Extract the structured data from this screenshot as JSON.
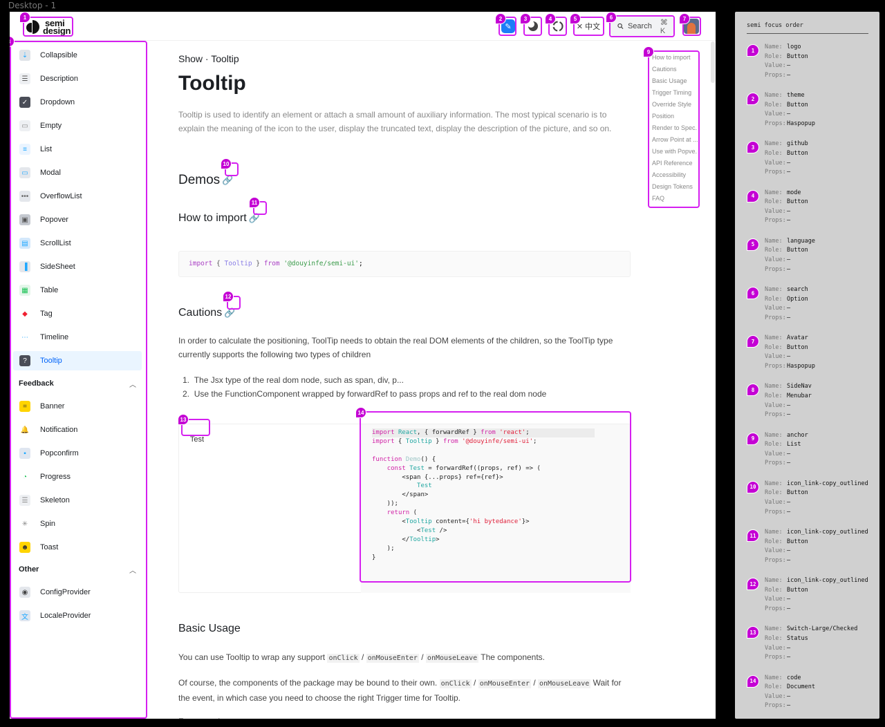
{
  "frame_label": "Desktop - 1",
  "header": {
    "logo_line1": "semi",
    "logo_line2": "design",
    "language_label": "中文",
    "search_label": "Search",
    "search_shortcut": "⌘ K",
    "icons": [
      "theme-icon",
      "mode-icon",
      "github-icon",
      "translate-icon",
      "search-icon",
      "avatar"
    ]
  },
  "sidebar": {
    "items_top": [
      {
        "label": "Collapsible",
        "icon": "collapsible-icon"
      },
      {
        "label": "Description",
        "icon": "description-icon"
      },
      {
        "label": "Dropdown",
        "icon": "dropdown-icon"
      },
      {
        "label": "Empty",
        "icon": "empty-icon"
      },
      {
        "label": "List",
        "icon": "list-icon"
      },
      {
        "label": "Modal",
        "icon": "modal-icon"
      },
      {
        "label": "OverflowList",
        "icon": "overflowlist-icon"
      },
      {
        "label": "Popover",
        "icon": "popover-icon"
      },
      {
        "label": "ScrollList",
        "icon": "scrolllist-icon"
      },
      {
        "label": "SideSheet",
        "icon": "sidesheet-icon"
      },
      {
        "label": "Table",
        "icon": "table-icon"
      },
      {
        "label": "Tag",
        "icon": "tag-icon"
      },
      {
        "label": "Timeline",
        "icon": "timeline-icon"
      },
      {
        "label": "Tooltip",
        "icon": "tooltip-icon",
        "active": true
      }
    ],
    "group_feedback": "Feedback",
    "items_feedback": [
      {
        "label": "Banner",
        "icon": "banner-icon"
      },
      {
        "label": "Notification",
        "icon": "notification-icon"
      },
      {
        "label": "Popconfirm",
        "icon": "popconfirm-icon"
      },
      {
        "label": "Progress",
        "icon": "progress-icon"
      },
      {
        "label": "Skeleton",
        "icon": "skeleton-icon"
      },
      {
        "label": "Spin",
        "icon": "spin-icon"
      },
      {
        "label": "Toast",
        "icon": "toast-icon"
      }
    ],
    "group_other": "Other",
    "items_other": [
      {
        "label": "ConfigProvider",
        "icon": "configprovider-icon"
      },
      {
        "label": "LocaleProvider",
        "icon": "localeprovider-icon"
      }
    ]
  },
  "main": {
    "breadcrumb": "Show · Tooltip",
    "title": "Tooltip",
    "intro": "Tooltip is used to identify an element or attach a small amount of auxiliary information. The most typical scenario is to explain the meaning of the icon to the user, display the truncated text, display the description of the picture, and so on.",
    "demos_heading": "Demos",
    "how_to_import_heading": "How to import",
    "import_code": {
      "kw": "import",
      "open": " { ",
      "cmp": "Tooltip",
      "close": " } ",
      "from": "from",
      "str": " '@douyinfe/semi-ui'",
      "end": ";"
    },
    "cautions_heading": "Cautions",
    "cautions_text": "In order to calculate the positioning, ToolTip needs to obtain the real DOM elements of the children, so the ToolTip type currently supports the following two types of children",
    "cautions_list": [
      "The Jsx type of the real dom node, such as span, div, p...",
      "Use the FunctionComponent wrapped by forwardRef to pass props and ref to the real dom node"
    ],
    "demo_test_label": "Test",
    "basic_usage_heading": "Basic Usage",
    "basic_p1_before": "You can use Tooltip to wrap any support ",
    "basic_p1_after": " The components.",
    "basic_p2_before": "Of course, the components of the package may be bound to their own. ",
    "basic_p2_after": " Wait for the event, in which case you need to choose the right Trigger time for Tooltip.",
    "code_onclick": "onClick",
    "code_onmouseenter": "onMouseEnter",
    "code_onmouseleave": "onMouseLeave",
    "slash": " / ",
    "for_example": "For example:"
  },
  "anchor": {
    "items": [
      "How to import",
      "Cautions",
      "Basic Usage",
      "Trigger Timing",
      "Override Style",
      "Position",
      "Render to Spec.",
      "Arrow Point at ...",
      "Use with Popve.",
      "API Reference",
      "Accessibility",
      "Design Tokens",
      "FAQ"
    ]
  },
  "focus_panel": {
    "title": "semi focus order",
    "keys": {
      "name": "Name:",
      "role": "Role:",
      "value": "Value:",
      "props": "Props:"
    },
    "entries": [
      {
        "n": "1",
        "name": "logo",
        "role": "Button",
        "value": "–",
        "props": "–"
      },
      {
        "n": "2",
        "name": "theme",
        "role": "Button",
        "value": "–",
        "props": "Haspopup"
      },
      {
        "n": "3",
        "name": "github",
        "role": "Button",
        "value": "–",
        "props": "–"
      },
      {
        "n": "4",
        "name": "mode",
        "role": "Button",
        "value": "–",
        "props": "–"
      },
      {
        "n": "5",
        "name": "language",
        "role": "Button",
        "value": "–",
        "props": "–"
      },
      {
        "n": "6",
        "name": "search",
        "role": "Option",
        "value": "–",
        "props": "–"
      },
      {
        "n": "7",
        "name": "Avatar",
        "role": "Button",
        "value": "–",
        "props": "Haspopup"
      },
      {
        "n": "8",
        "name": "SideNav",
        "role": "Menubar",
        "value": "–",
        "props": "–"
      },
      {
        "n": "9",
        "name": "anchor",
        "role": "List",
        "value": "–",
        "props": "–"
      },
      {
        "n": "10",
        "name": "icon_link-copy_outlined",
        "role": "Button",
        "value": "–",
        "props": "–"
      },
      {
        "n": "11",
        "name": "icon_link-copy_outlined",
        "role": "Button",
        "value": "–",
        "props": "–"
      },
      {
        "n": "12",
        "name": "icon_link-copy_outlined",
        "role": "Button",
        "value": "–",
        "props": "–"
      },
      {
        "n": "13",
        "name": "Switch-Large/Checked",
        "role": "Status",
        "value": "–",
        "props": "–"
      },
      {
        "n": "14",
        "name": "code",
        "role": "Document",
        "value": "–",
        "props": "–"
      }
    ]
  },
  "colors": {
    "focus_magenta": "#d51ff0",
    "badge": "#c400d4",
    "active_nav_bg": "#eaf5ff",
    "active_nav_text": "#0064fa",
    "brand_blue": "#1c7df8"
  }
}
